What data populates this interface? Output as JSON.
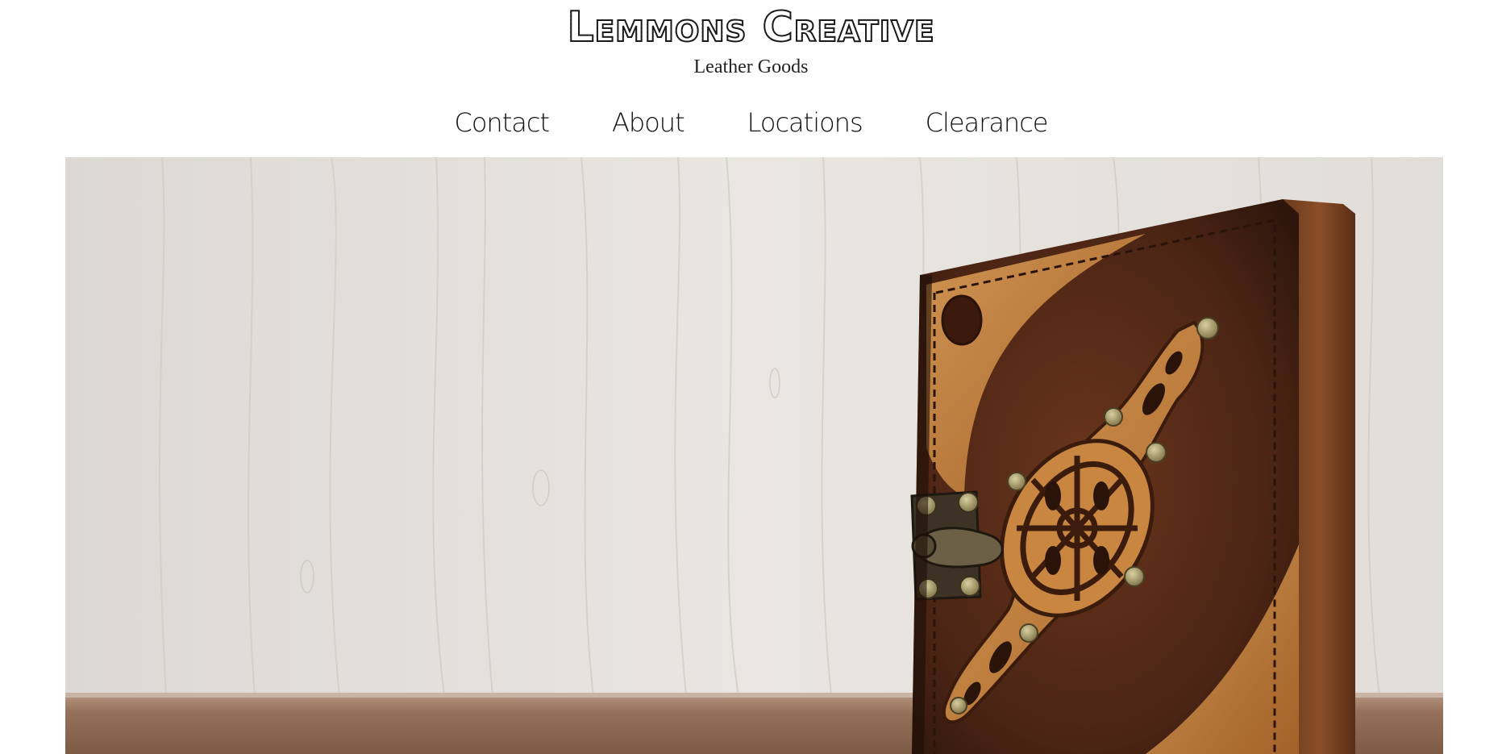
{
  "site": {
    "title": "Lemmons Creative",
    "tagline": "Leather Goods"
  },
  "nav": {
    "items": [
      {
        "label": "Contact"
      },
      {
        "label": "About"
      },
      {
        "label": "Locations"
      },
      {
        "label": "Clearance"
      }
    ]
  },
  "hero": {
    "image_subject": "leather-journal-photo",
    "colors": {
      "wall": "#e4e1dc",
      "table": "#8f6a52",
      "leather_dark": "#4a2414",
      "leather_light": "#c7833a",
      "brass": "#9c8f63"
    }
  }
}
